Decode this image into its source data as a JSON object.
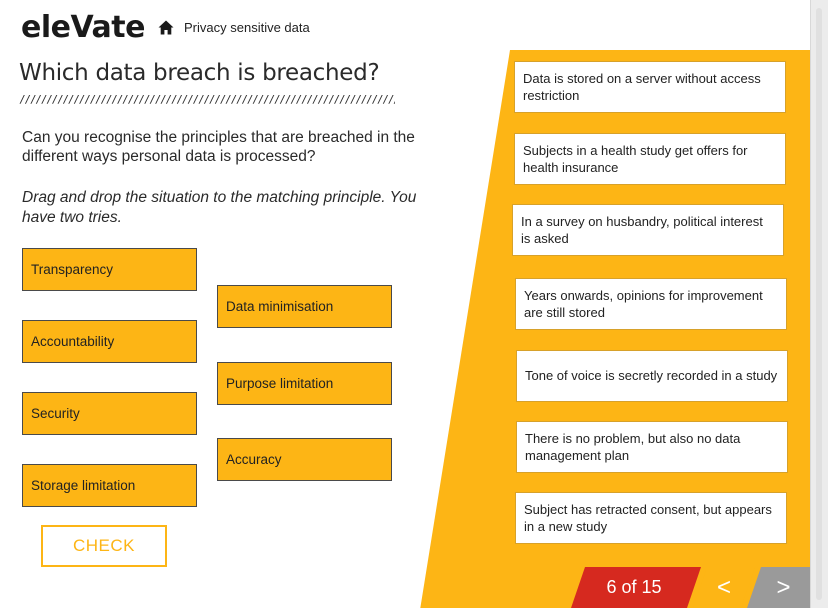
{
  "header": {
    "logo": "eleVate",
    "breadcrumb": "Privacy sensitive data",
    "breadcrumb_icon": "home-icon"
  },
  "question": {
    "title": "Which data breach is breached?",
    "intro": "Can you recognise the principles that are breached in the different ways personal data is processed?",
    "instructions": "Drag and drop the situation to the matching principle. You have two tries."
  },
  "principles": [
    "Transparency",
    "Data minimisation",
    "Accountability",
    "Purpose limitation",
    "Security",
    "Accuracy",
    "Storage limitation"
  ],
  "check_label": "CHECK",
  "scenarios": [
    "Data is stored on a server without access restriction",
    "Subjects in a health study get offers for health insurance",
    "In a survey on husbandry, political interest is asked",
    "Years onwards, opinions for improvement are still stored",
    "Tone of voice is secretly recorded in a study",
    "There is no problem, but also no data management plan",
    "Subject has retracted consent, but appears in a new study"
  ],
  "navigation": {
    "page_indicator": "6 of 15",
    "prev_label": "<",
    "next_label": ">"
  },
  "colors": {
    "accent": "#fdb515",
    "page_indicator": "#d6291f",
    "next_disabled": "#9a9a9a"
  }
}
